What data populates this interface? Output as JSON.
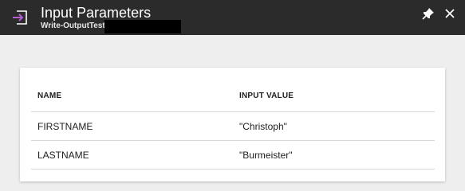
{
  "header": {
    "title": "Input Parameters",
    "subtitle": "Write-OutputTest",
    "icon": "runbook-input-icon",
    "pin_icon": "pin-icon",
    "close_icon": "close-icon",
    "background": "#2b2b2b",
    "icon_accent": "#b15fd1"
  },
  "table": {
    "columns": [
      "NAME",
      "INPUT VALUE"
    ],
    "rows": [
      {
        "name": "FIRSTNAME",
        "value": "\"Christoph\""
      },
      {
        "name": "LASTNAME",
        "value": "\"Burmeister\""
      }
    ]
  }
}
